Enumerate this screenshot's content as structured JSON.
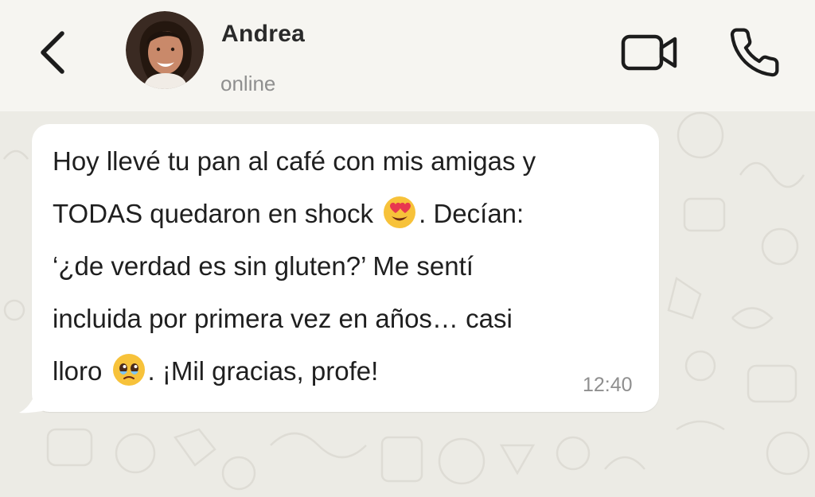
{
  "header": {
    "back_icon": "chevron-left-icon",
    "contact_name": "Andrea",
    "contact_status": "online",
    "video_icon": "video-camera-icon",
    "call_icon": "phone-icon"
  },
  "message": {
    "lines": [
      "Hoy llevé tu pan al café con mis amigas y",
      "TODAS quedaron en shock",
      ". Decían:",
      "‘¿de verdad es sin gluten?’ Me sentí",
      "incluida por primera vez en años… casi",
      "lloro",
      ". ¡Mil gracias, profe!"
    ],
    "time": "12:40",
    "emojis": [
      "heart-eyes-emoji",
      "pleading-face-emoji"
    ]
  },
  "colors": {
    "header_bg": "#f6f5f1",
    "chat_bg": "#ecebe5",
    "bubble_bg": "#ffffff",
    "text": "#1f1f1f",
    "muted": "#8f8f8f"
  }
}
